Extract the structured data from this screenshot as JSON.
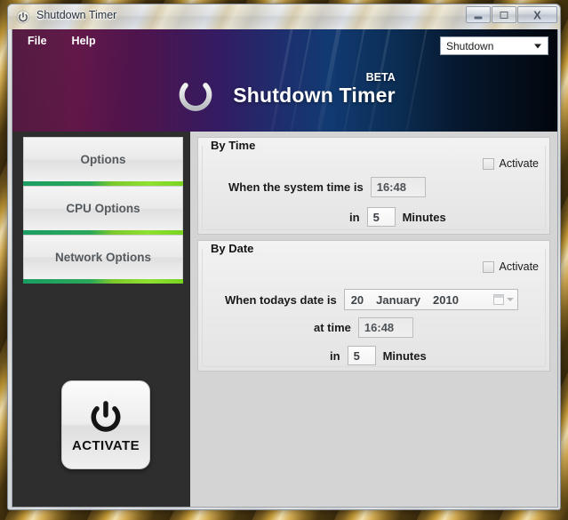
{
  "window": {
    "title": "Shutdown Timer",
    "icon": "power-icon",
    "buttons": {
      "minimize": "minimize-icon",
      "maximize": "maximize-icon",
      "close": "X"
    }
  },
  "menubar": {
    "items": [
      {
        "label": "File"
      },
      {
        "label": "Help"
      }
    ]
  },
  "mode_combo": {
    "value": "Shutdown",
    "icon": "chevron-down-icon"
  },
  "banner": {
    "logo_icon": "power-icon",
    "title": "Shutdown Timer",
    "badge": "BETA"
  },
  "sidebar": {
    "tabs": [
      {
        "label": "Options"
      },
      {
        "label": "CPU Options"
      },
      {
        "label": "Network Options"
      }
    ],
    "activate_button": {
      "label": "ACTIVATE",
      "icon": "power-icon"
    }
  },
  "main": {
    "by_time": {
      "title": "By Time",
      "activate_label": "Activate",
      "activate_checked": false,
      "time_label": "When the system time is",
      "time_value": "16:48",
      "in_label": "in",
      "minutes_value": "5",
      "minutes_unit": "Minutes"
    },
    "by_date": {
      "title": "By Date",
      "activate_label": "Activate",
      "activate_checked": false,
      "date_label": "When todays date is",
      "date_day": "20",
      "date_month": "January",
      "date_year": "2010",
      "date_picker_icon": "calendar-icon",
      "time_label": "at time",
      "time_value": "16:48",
      "in_label": "in",
      "minutes_value": "5",
      "minutes_unit": "Minutes"
    }
  },
  "colors": {
    "banner_start": "#4b0f37",
    "banner_mid": "#1d2f6e",
    "banner_end": "#02060d",
    "tab_underline_start": "#1a9e62",
    "tab_underline_end": "#79d421",
    "sidebar_bg": "#2e2e2e",
    "panel_bg": "#d4d4d4"
  }
}
